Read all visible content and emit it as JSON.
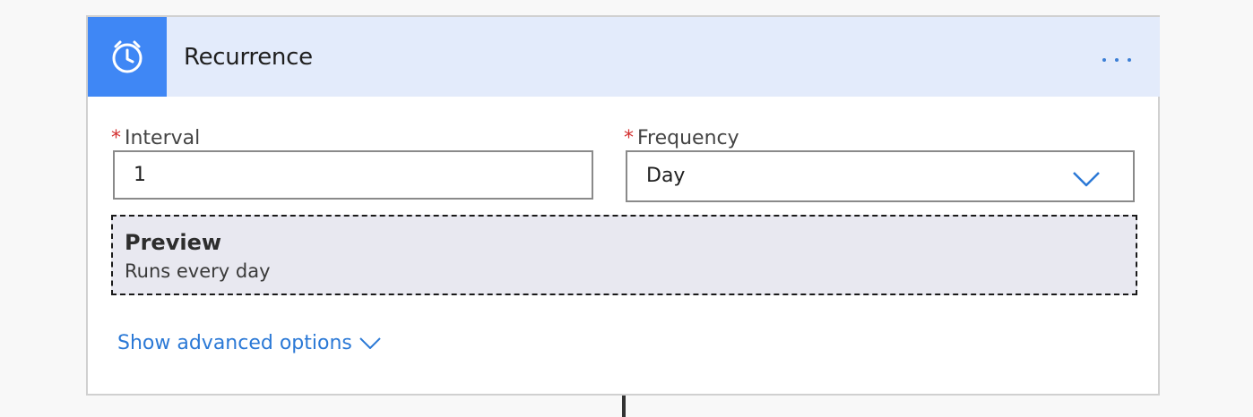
{
  "card": {
    "title": "Recurrence",
    "icon": "alarm-clock-icon",
    "more_icon": "more-dots-icon"
  },
  "interval": {
    "required_mark": "*",
    "label": "Interval",
    "value": "1"
  },
  "frequency": {
    "required_mark": "*",
    "label": "Frequency",
    "selected": "Day",
    "icon": "chevron-down-icon"
  },
  "preview": {
    "title": "Preview",
    "text": "Runs every day"
  },
  "advanced": {
    "label": "Show advanced options",
    "icon": "chevron-down-icon"
  },
  "colors": {
    "accent": "#3f87f5",
    "header_bg": "#e3ebfb",
    "link": "#2b79d6",
    "required": "#d32f2f",
    "preview_bg": "#e8e8f0"
  }
}
